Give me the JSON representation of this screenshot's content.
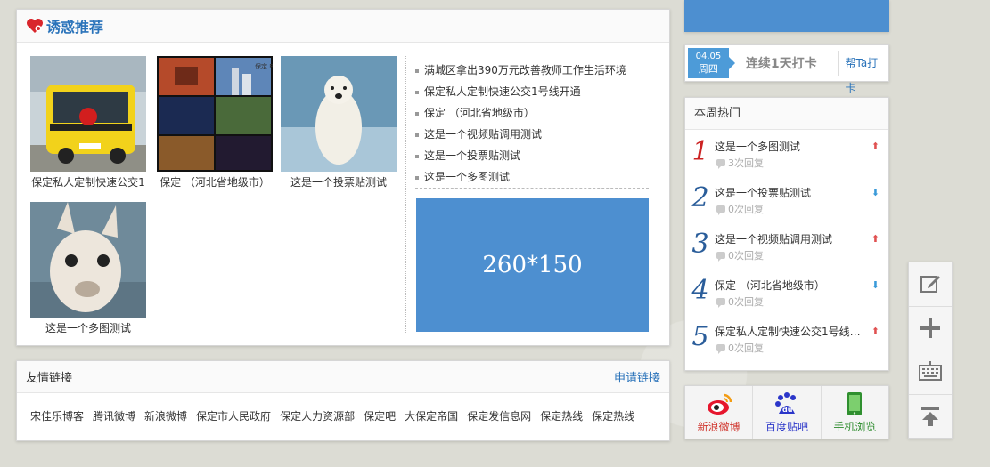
{
  "recommend": {
    "title": "诱惑推荐",
    "pics": [
      {
        "caption": "保定私人定制快速公交1"
      },
      {
        "caption": "保定 （河北省地级市）",
        "photo_text": "保定 Baoding"
      },
      {
        "caption": "这是一个投票贴测试"
      },
      {
        "caption": "这是一个多图测试"
      }
    ],
    "news": [
      "满城区拿出390万元改善教师工作生活环境",
      "保定私人定制快速公交1号线开通",
      "保定 （河北省地级市）",
      "这是一个视频贴调用测试",
      "这是一个投票贴测试",
      "这是一个多图测试"
    ],
    "ad_label": "260*150"
  },
  "links": {
    "title": "友情链接",
    "apply_label": "申请链接",
    "items": [
      "宋佳乐博客",
      "腾讯微博",
      "新浪微博",
      "保定市人民政府",
      "保定人力资源部",
      "保定吧",
      "大保定帝国",
      "保定发信息网",
      "保定热线",
      "保定热线"
    ]
  },
  "checkin": {
    "date": "04.05",
    "weekday": "周四",
    "status": "连续1天打卡",
    "button": "帮Ta打卡"
  },
  "hot": {
    "title": "本周热门",
    "items": [
      {
        "rank": "1",
        "title": "这是一个多图测试",
        "replies": "3次回复",
        "trend": "up"
      },
      {
        "rank": "2",
        "title": "这是一个投票贴测试",
        "replies": "0次回复",
        "trend": "down"
      },
      {
        "rank": "3",
        "title": "这是一个视频贴调用测试",
        "replies": "0次回复",
        "trend": "up"
      },
      {
        "rank": "4",
        "title": "保定 （河北省地级市）",
        "replies": "0次回复",
        "trend": "down"
      },
      {
        "rank": "5",
        "title": "保定私人定制快速公交1号线…",
        "replies": "0次回复",
        "trend": "up"
      }
    ],
    "colors": {
      "rank1": "#cc2222",
      "rank_other": "#2a5d9a",
      "up": "#e05050",
      "down": "#3a9ad9"
    }
  },
  "share": [
    {
      "label": "新浪微博",
      "icon": "weibo-icon",
      "color": "#d0342c"
    },
    {
      "label": "百度贴吧",
      "icon": "baidu-tieba-icon",
      "color": "#2b36c9"
    },
    {
      "label": "手机浏览",
      "icon": "mobile-icon",
      "color": "#2a8a2a"
    }
  ],
  "tools": [
    "edit-icon",
    "plus-icon",
    "keyboard-icon",
    "back-to-top-icon"
  ],
  "accent": "#4d8fd0"
}
